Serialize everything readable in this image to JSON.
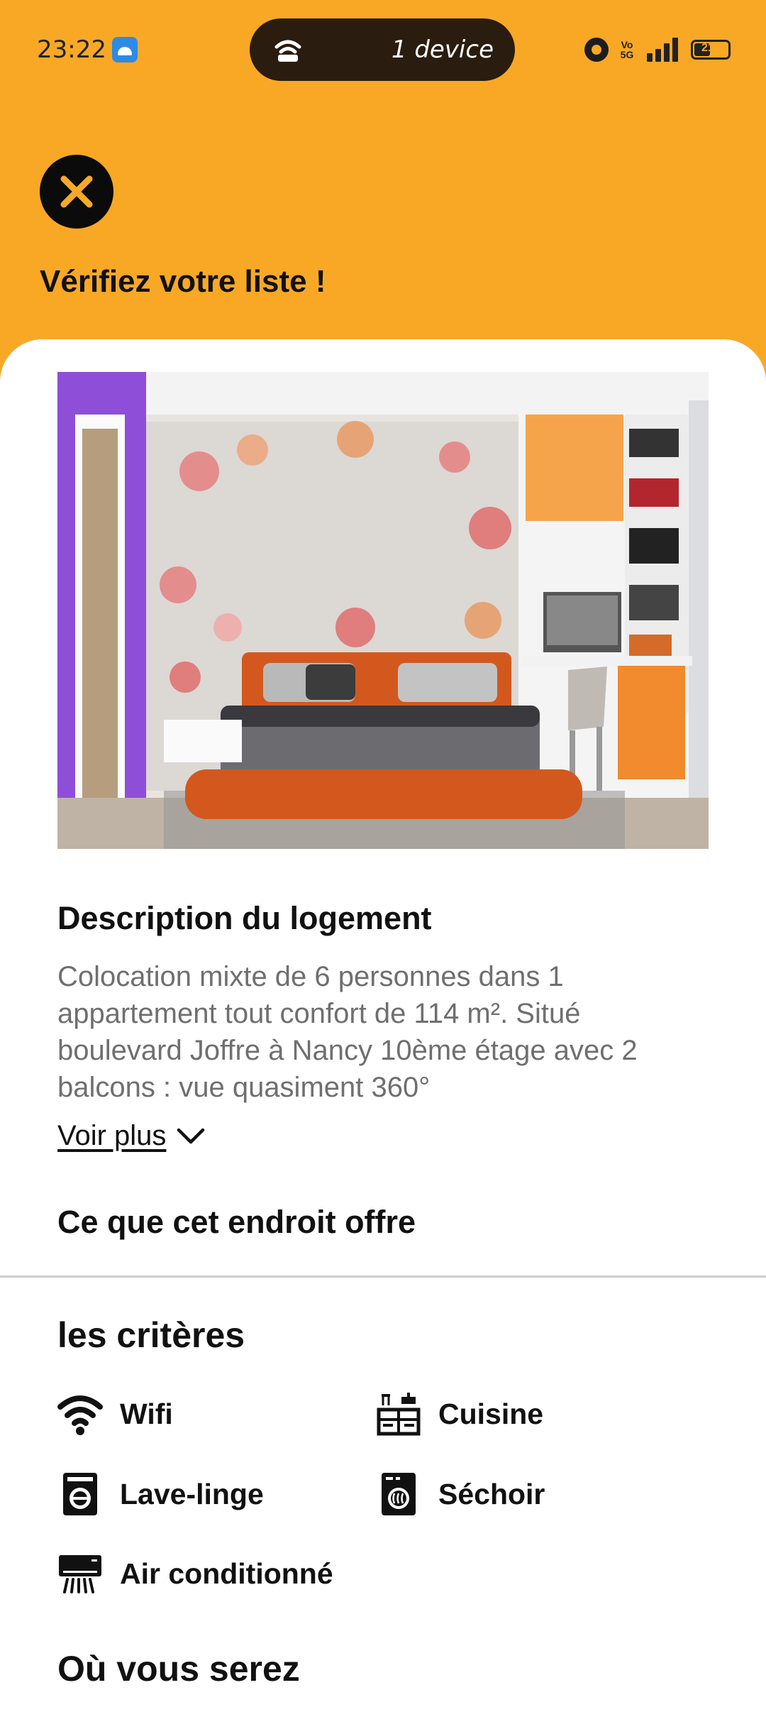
{
  "status_bar": {
    "time": "23:22",
    "hotspot_text": "1 device",
    "battery": "21",
    "network": "5G",
    "volte": "Vo 5G"
  },
  "header": {
    "title": "Vérifiez votre liste !"
  },
  "listing": {
    "image_icon": "bedroom-photo",
    "description_title": "Description du logement",
    "description": "Colocation mixte de 6 personnes dans 1 appartement tout confort de 114 m². Situé boulevard Joffre à Nancy 10ème étage avec 2 balcons : vue quasiment 360°",
    "see_more": "Voir plus",
    "offers_title": "Ce que cet endroit offre",
    "criteria_title": "les critères",
    "criteria": [
      {
        "label": "Wifi",
        "icon": "wifi-icon"
      },
      {
        "label": "Cuisine",
        "icon": "kitchen-icon"
      },
      {
        "label": "Lave-linge",
        "icon": "washing-machine-icon"
      },
      {
        "label": "Séchoir",
        "icon": "dryer-icon"
      },
      {
        "label": "Air conditionné",
        "icon": "air-conditioner-icon"
      }
    ],
    "location_title": "Où vous serez"
  },
  "colors": {
    "brand": "#F9A826",
    "text": "#111111",
    "muted": "#6F6F6F"
  }
}
